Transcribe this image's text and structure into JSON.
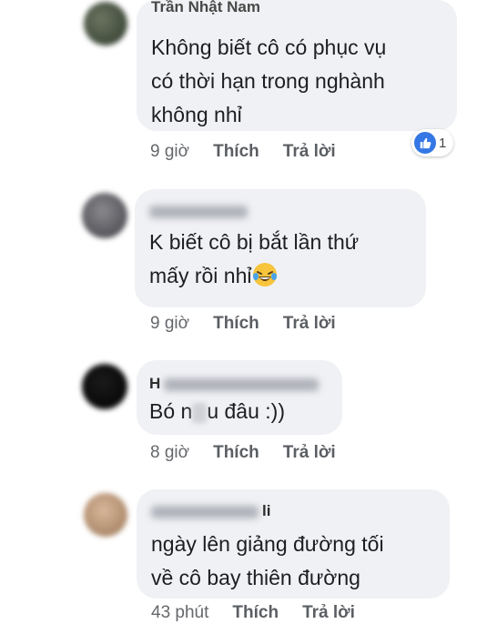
{
  "comments": [
    {
      "author": "Trần Nhật Nam",
      "body": "Không biết cô có phục vụ\ncó thời hạn trong nghành\nkhông nhỉ",
      "time": "9 giờ",
      "like_label": "Thích",
      "reply_label": "Trả lời",
      "reaction_count": "1"
    },
    {
      "author": "",
      "body": "K biết cô bị bắt lần thứ\nmấy rồi nhỉ",
      "time": "9 giờ",
      "like_label": "Thích",
      "reply_label": "Trả lời"
    },
    {
      "author_visible": "H",
      "body_start": "Bó n",
      "body_end": "u đâu :))",
      "time": "8 giờ",
      "like_label": "Thích",
      "reply_label": "Trả lời"
    },
    {
      "author_visible": "li",
      "body": "ngày lên giảng đường tối\nvề cô bay thiên đường",
      "time": "43 phút",
      "like_label": "Thích",
      "reply_label": "Trả lời"
    }
  ],
  "colors": {
    "bubble": "#f0f1f4",
    "meta": "#65676b",
    "like_blue": "#3578e5"
  },
  "icons": {
    "reaction": "thumbs-up-icon",
    "emoji": "laughing-tears-emoji-icon"
  }
}
